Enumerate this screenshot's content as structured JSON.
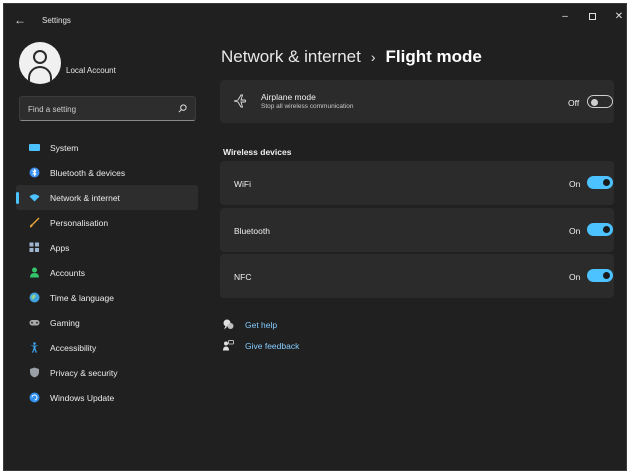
{
  "window": {
    "title": "Settings",
    "controls": {
      "minimize": "–",
      "close": "✕"
    }
  },
  "account": {
    "name": "Local Account"
  },
  "search": {
    "placeholder": "Find a setting"
  },
  "sidebar": {
    "items": [
      {
        "label": "System",
        "icon": "system-icon",
        "color": "#4cc2ff"
      },
      {
        "label": "Bluetooth & devices",
        "icon": "bluetooth-icon",
        "color": "#3b8ff0"
      },
      {
        "label": "Network & internet",
        "icon": "wifi-icon",
        "color": "#4cc2ff",
        "selected": true
      },
      {
        "label": "Personalisation",
        "icon": "brush-icon",
        "color": "#e8a23a"
      },
      {
        "label": "Apps",
        "icon": "apps-icon",
        "color": "#a0b4d0"
      },
      {
        "label": "Accounts",
        "icon": "person-icon",
        "color": "#34c46a"
      },
      {
        "label": "Time & language",
        "icon": "globe-clock-icon",
        "color": "#3fa3e0"
      },
      {
        "label": "Gaming",
        "icon": "gamepad-icon",
        "color": "#a8a8a8"
      },
      {
        "label": "Accessibility",
        "icon": "accessibility-icon",
        "color": "#3fa3f0"
      },
      {
        "label": "Privacy & security",
        "icon": "shield-icon",
        "color": "#9aa0a6"
      },
      {
        "label": "Windows Update",
        "icon": "update-icon",
        "color": "#2f8ff0"
      }
    ]
  },
  "breadcrumb": {
    "parent": "Network & internet",
    "separator": "›",
    "current": "Flight mode"
  },
  "airplane": {
    "title": "Airplane mode",
    "subtitle": "Stop all wireless communication",
    "state": "Off"
  },
  "wireless": {
    "heading": "Wireless devices",
    "devices": [
      {
        "label": "WiFi",
        "state": "On"
      },
      {
        "label": "Bluetooth",
        "state": "On"
      },
      {
        "label": "NFC",
        "state": "On"
      }
    ]
  },
  "links": {
    "help": "Get help",
    "feedback": "Give feedback"
  },
  "colors": {
    "accent": "#4cc2ff",
    "background": "#202020",
    "card": "#2b2b2b"
  }
}
